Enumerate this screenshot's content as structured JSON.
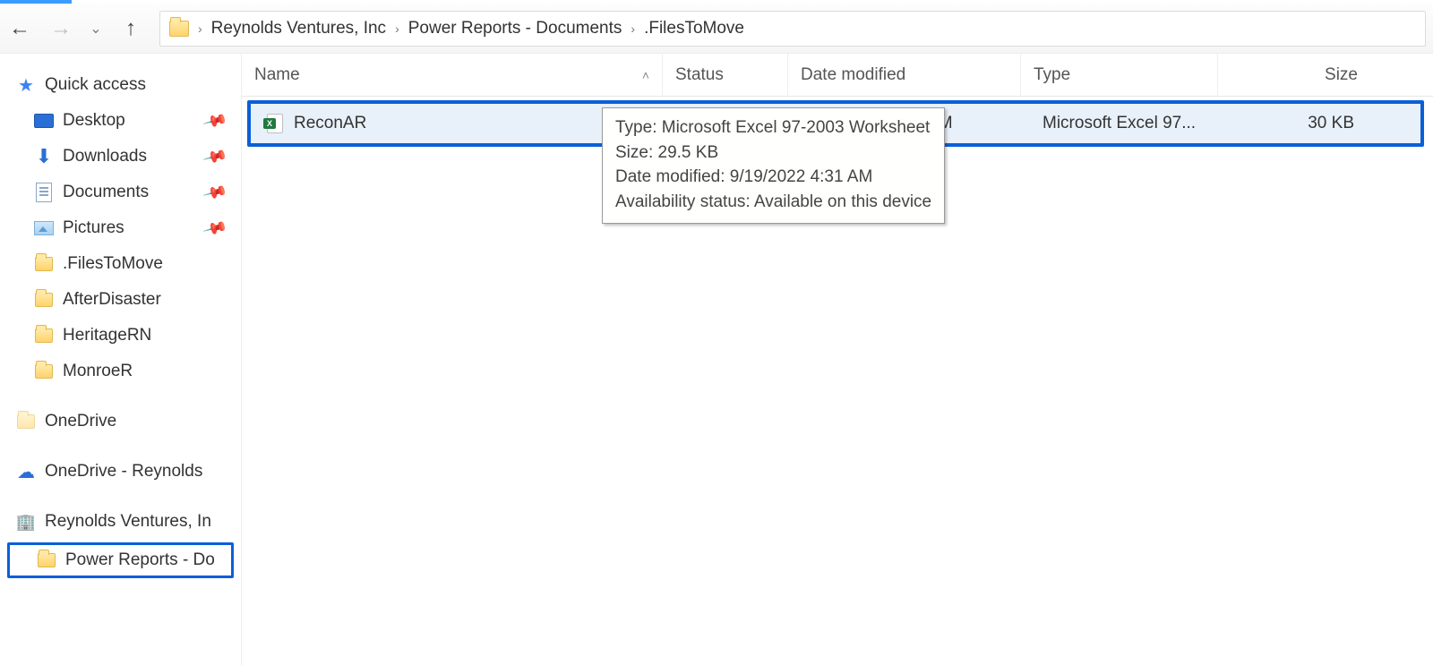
{
  "breadcrumb": {
    "segments": [
      "Reynolds Ventures, Inc",
      "Power Reports - Documents",
      ".FilesToMove"
    ]
  },
  "sidebar": {
    "quick_access": "Quick access",
    "items": [
      {
        "label": "Desktop",
        "pinned": true,
        "icon": "desktop"
      },
      {
        "label": "Downloads",
        "pinned": true,
        "icon": "download"
      },
      {
        "label": "Documents",
        "pinned": true,
        "icon": "document"
      },
      {
        "label": "Pictures",
        "pinned": true,
        "icon": "pictures"
      },
      {
        "label": ".FilesToMove",
        "pinned": false,
        "icon": "folder"
      },
      {
        "label": "AfterDisaster",
        "pinned": false,
        "icon": "folder"
      },
      {
        "label": "HeritageRN",
        "pinned": false,
        "icon": "folder"
      },
      {
        "label": "MonroeR",
        "pinned": false,
        "icon": "folder"
      }
    ],
    "onedrive": "OneDrive",
    "onedrive_work": "OneDrive - Reynolds",
    "org": "Reynolds Ventures, In",
    "org_sub": "Power Reports - Do"
  },
  "columns": {
    "name": "Name",
    "status": "Status",
    "date": "Date modified",
    "type": "Type",
    "size": "Size"
  },
  "rows": [
    {
      "name": "ReconAR",
      "status": "available",
      "date": "9/19/2022 4:31 AM",
      "type": "Microsoft Excel 97...",
      "size": "30 KB"
    }
  ],
  "tooltip": {
    "line1": "Type: Microsoft Excel 97-2003 Worksheet",
    "line2": "Size: 29.5 KB",
    "line3": "Date modified: 9/19/2022 4:31 AM",
    "line4": "Availability status: Available on this device"
  }
}
